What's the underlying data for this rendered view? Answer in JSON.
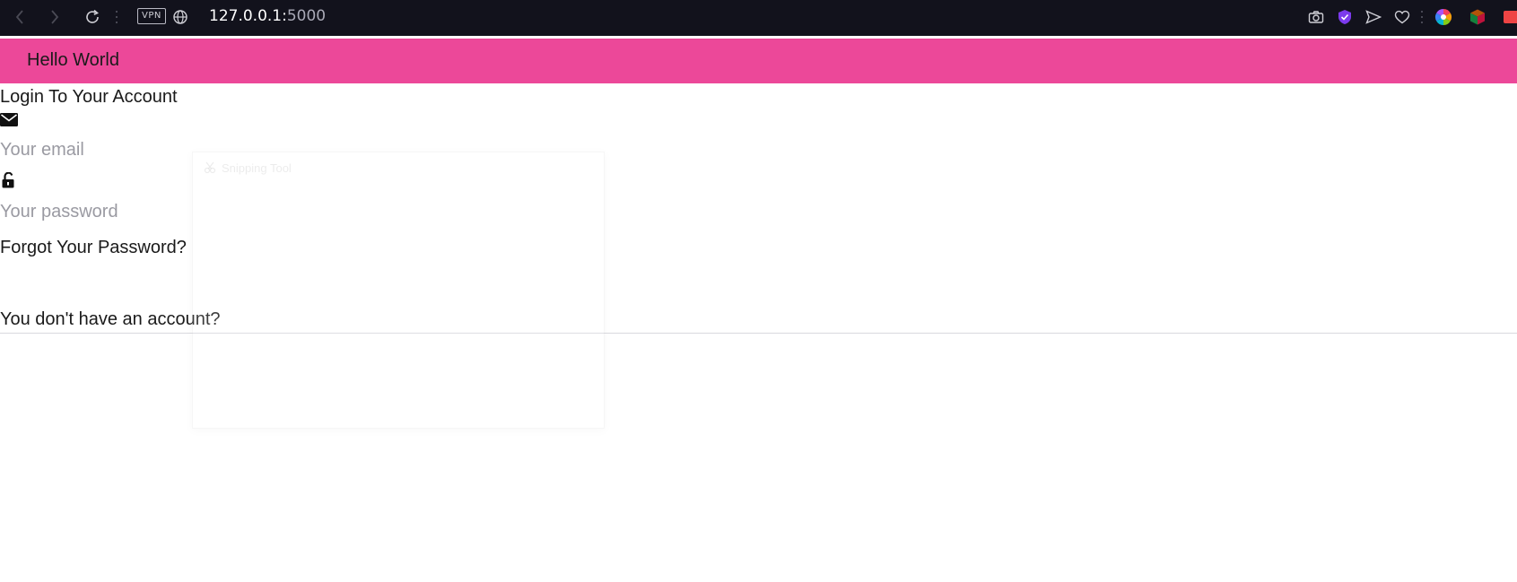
{
  "browser": {
    "vpn_label": "VPN",
    "url_host": "127.0.0.1:",
    "url_port": "5000",
    "icons": [
      "back-icon",
      "forward-icon",
      "reload-icon",
      "globe-icon",
      "camera-icon",
      "shield-icon",
      "send-icon",
      "heart-icon",
      "color-wheel-icon",
      "cube-icon"
    ]
  },
  "header": {
    "brand": "Hello World",
    "color": "#ec4899"
  },
  "login": {
    "title": "Login To Your Account",
    "email_placeholder": "Your email",
    "password_placeholder": "Your password",
    "forgot_label": "Forgot Your Password?",
    "signup_prompt": "You don't have an account?"
  },
  "overlay": {
    "title": "Snipping Tool"
  }
}
